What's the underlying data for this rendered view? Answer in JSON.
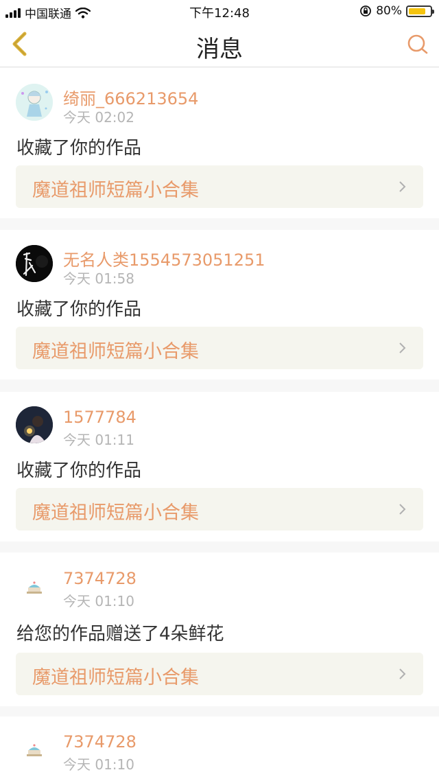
{
  "status_bar": {
    "carrier": "中国联通",
    "time": "下午12:48",
    "battery_percent": "80%",
    "battery_level": 0.8,
    "battery_color": "#f5c40f"
  },
  "header": {
    "title": "消息",
    "back_icon": "chevron-left-icon",
    "search_icon": "search-icon",
    "accent_color": "#e89a6a"
  },
  "notifications": [
    {
      "username": "绮丽_666213654",
      "time": "今天 02:02",
      "action": "收藏了你的作品",
      "work_title": "魔道祖师短篇小合集",
      "avatar": "anime-girl-avatar"
    },
    {
      "username": "无名人类1554573051251",
      "time": "今天 01:58",
      "action": "收藏了你的作品",
      "work_title": "魔道祖师短篇小合集",
      "avatar": "dark-calligraphy-avatar"
    },
    {
      "username": "1577784",
      "time": "今天 01:11",
      "action": "收藏了你的作品",
      "work_title": "魔道祖师短篇小合集",
      "avatar": "night-photo-avatar"
    },
    {
      "username": "7374728",
      "time": "今天 01:10",
      "action": "给您的作品赠送了4朵鲜花",
      "work_title": "魔道祖师短篇小合集",
      "avatar": "cake-avatar"
    },
    {
      "username": "7374728",
      "time": "今天 01:10",
      "action": "",
      "work_title": "",
      "avatar": "cake-avatar"
    }
  ]
}
